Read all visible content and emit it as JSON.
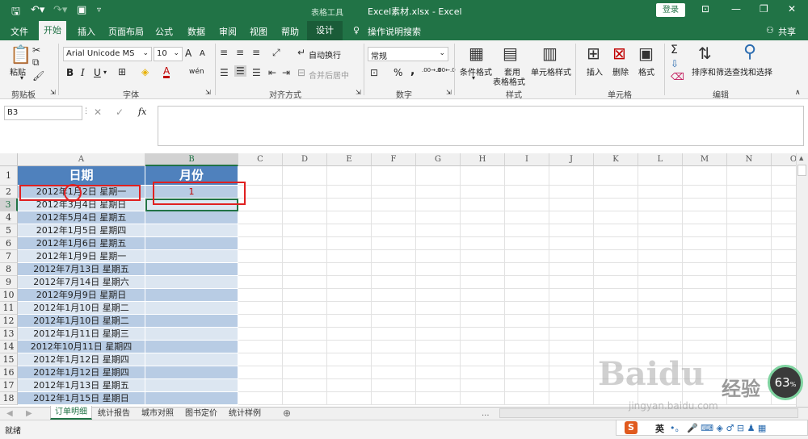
{
  "titlebar": {
    "quick_access": {
      "save_icon": "save-icon",
      "undo_icon": "undo-icon",
      "redo_icon": "redo-icon",
      "preview_icon": "print-preview-icon",
      "customize_icon": "customize-icon"
    },
    "context_tools": "表格工具",
    "document_title": "Excel素材.xlsx  -  Excel",
    "login_label": "登录",
    "window_buttons": [
      "ribbon-display-icon",
      "minimize-icon",
      "restore-icon",
      "close-icon"
    ]
  },
  "tabs": {
    "file": "文件",
    "home": "开始",
    "insert": "插入",
    "page_layout": "页面布局",
    "formulas": "公式",
    "data": "数据",
    "review": "审阅",
    "view": "视图",
    "help": "帮助",
    "design": "设计",
    "tell_me": "操作说明搜索",
    "share": "共享"
  },
  "ribbon": {
    "clipboard": {
      "paste": "粘贴",
      "label": "剪贴板"
    },
    "font": {
      "font_name": "Arial Unicode MS",
      "font_size": "10",
      "grow": "A",
      "shrink": "A",
      "bold": "B",
      "italic": "I",
      "underline": "U",
      "label": "字体",
      "phonetic": "wén"
    },
    "alignment": {
      "wrap_text": "自动换行",
      "merge_center": "合并后居中",
      "label": "对齐方式"
    },
    "number": {
      "format": "常规",
      "percent": "%",
      "comma": ",",
      "inc_decimal": ".00→.0",
      "dec_decimal": ".00←.0",
      "label": "数字"
    },
    "styles": {
      "conditional": "条件格式",
      "format_table_1": "套用",
      "format_table_2": "表格格式",
      "cell_styles": "单元格样式",
      "label": "样式"
    },
    "cells": {
      "insert": "插入",
      "delete": "删除",
      "format": "格式",
      "label": "单元格"
    },
    "editing": {
      "sort_filter": "排序和筛选",
      "find_select": "查找和选择",
      "label": "编辑",
      "sum": "Σ"
    }
  },
  "formula_bar": {
    "name_box": "B3",
    "cancel": "✕",
    "enter": "✓",
    "fx": "fx",
    "content": ""
  },
  "grid": {
    "columns": [
      "A",
      "B",
      "C",
      "D",
      "E",
      "F",
      "G",
      "H",
      "I",
      "J",
      "K",
      "L",
      "M",
      "N",
      "O"
    ],
    "rows": [
      "1",
      "2",
      "3",
      "4",
      "5",
      "6",
      "7",
      "8",
      "9",
      "10",
      "11",
      "12",
      "13",
      "14",
      "15",
      "16",
      "17",
      "18"
    ],
    "header": {
      "a": "日期",
      "b": "月份"
    },
    "dates": [
      "2012年1月2日 星期一",
      "2012年3月4日 星期日",
      "2012年5月4日 星期五",
      "2012年1月5日 星期四",
      "2012年1月6日 星期五",
      "2012年1月9日 星期一",
      "2012年7月13日 星期五",
      "2012年7月14日 星期六",
      "2012年9月9日 星期日",
      "2012年1月10日 星期二",
      "2012年1月10日 星期二",
      "2012年1月11日 星期三",
      "2012年10月11日 星期四",
      "2012年1月12日 星期四",
      "2012年1月12日 星期四",
      "2012年1月13日 星期五",
      "2012年1月15日 星期日"
    ],
    "b2_value": "1",
    "b2_color": "#c00000"
  },
  "sheets": {
    "nav_prev": "◀",
    "nav_next": "▶",
    "tabs": [
      "订单明细",
      "统计报告",
      "城市对照",
      "图书定价",
      "统计样例"
    ],
    "add": "⊕",
    "more": "..."
  },
  "statusbar": {
    "ready": "就绪"
  },
  "watermark": {
    "baidu": "Baidu",
    "jingyan": "经验",
    "url": "jingyan.baidu.com",
    "zoom": "63",
    "zoom_unit": "%"
  },
  "ime": {
    "lang": "英"
  },
  "colors": {
    "excel_green": "#217346",
    "header_blue": "#4f81bd",
    "band_dark": "#b8cce4",
    "band_light": "#dce6f1",
    "annotation_red": "#e02020"
  }
}
